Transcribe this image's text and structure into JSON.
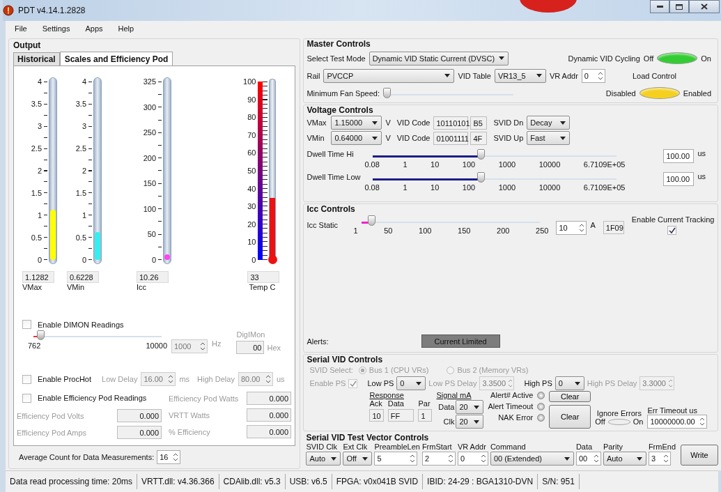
{
  "window": {
    "title": "PDT v4.14.1.2828"
  },
  "menu": [
    "File",
    "Settings",
    "Apps",
    "Help"
  ],
  "output": {
    "title": "Output",
    "tabs": [
      {
        "label": "Historical",
        "selected": false
      },
      {
        "label": "Scales and Efficiency Pod",
        "selected": true
      }
    ],
    "gauges": [
      {
        "kind": "tube",
        "ticks": [
          "4",
          "3.5",
          "3",
          "2.5",
          "2",
          "1.5",
          "1",
          "0.5",
          "0"
        ],
        "level": 0.282,
        "color": "#ffff00",
        "value": "1.1282",
        "label": "VMax"
      },
      {
        "kind": "tube",
        "ticks": [
          "4",
          "3.5",
          "3",
          "2.5",
          "2",
          "1.5",
          "1",
          "0.5",
          "0"
        ],
        "level": 0.156,
        "color": "#33f0f0",
        "value": "0.6228",
        "label": "VMin"
      },
      {
        "kind": "tube",
        "ticks": [
          "325",
          "300",
          "250",
          "200",
          "150",
          "100",
          "50",
          "0"
        ],
        "level": 0.032,
        "color": "#ff44ee",
        "value": "10.26",
        "label": "Icc"
      },
      {
        "kind": "thermometer",
        "ticks": [
          "100",
          "90",
          "80",
          "70",
          "60",
          "50",
          "40",
          "30",
          "20",
          "10",
          "0"
        ],
        "level": 0.33,
        "color": "#ee1111",
        "value": "33",
        "label": "Temp C"
      }
    ],
    "dimon": {
      "label": "Enable DIMON Readings",
      "checked": false,
      "min": "762",
      "max": "10000",
      "level": 0.03,
      "value": "1000",
      "unit": "Hz",
      "digimon_label": "DigIMon",
      "digimon_value": "00",
      "digimon_unit": "Hex",
      "disabled": true
    },
    "prochot": {
      "label": "Enable ProcHot",
      "checked": false,
      "disabled": true,
      "low_label": "Low Delay",
      "low_value": "16.00",
      "low_unit": "ms",
      "high_label": "High Delay",
      "high_value": "80.00",
      "high_unit": "us"
    },
    "efficiency": {
      "label": "Enable Efficiency Pod Readings",
      "checked": false,
      "disabled": true,
      "left_fields": [
        {
          "label": "Efficiency Pod Volts",
          "value": "0.000"
        },
        {
          "label": "Efficiency Pod Amps",
          "value": "0.000"
        }
      ],
      "right_fields": [
        {
          "label": "Efficiency Pod Watts",
          "value": "0.000"
        },
        {
          "label": "VRTT Watts",
          "value": "0.000"
        },
        {
          "label": "% Efficiency",
          "value": "0.000"
        }
      ]
    },
    "average": {
      "label": "Average Count for Data Measurements:",
      "value": "16"
    }
  },
  "master": {
    "title": "Master Controls",
    "mode_label": "Select Test Mode",
    "mode_value": "Dynamic VID Static Current  (DVSC)",
    "cycling": {
      "label": "Dynamic VID Cycling",
      "off": "Off",
      "on": "On",
      "color": "#33cc33"
    },
    "rail_label": "Rail",
    "rail_value": "PVCCP",
    "vid_table_label": "VID Table",
    "vid_table_value": "VR13_5",
    "vr_addr_label": "VR Addr",
    "vr_addr_value": "0",
    "load": {
      "label": "Load Control",
      "off": "Disabled",
      "on": "Enabled",
      "color": "#f5d020"
    },
    "fan": {
      "label": "Minimum Fan Speed:",
      "level": 0.0
    }
  },
  "voltage": {
    "title": "Voltage Controls",
    "rows": [
      {
        "label": "VMax",
        "value": "1.15000",
        "unit": "V",
        "code_label": "VID Code",
        "code": "10110101",
        "hex": "B5",
        "svid_label": "SVID Dn",
        "svid_value": "Decay"
      },
      {
        "label": "VMin",
        "value": "0.64000",
        "unit": "V",
        "code_label": "VID Code",
        "code": "01001111",
        "hex": "4F",
        "svid_label": "SVID Up",
        "svid_value": "Fast"
      }
    ],
    "dwell": [
      {
        "label": "Dwell Time Hi",
        "level": 0.44,
        "ticks": [
          "0.08",
          "1",
          "10",
          "100",
          "1000",
          "10000",
          "6.7109E+05"
        ],
        "value": "100.00",
        "unit": "us"
      },
      {
        "label": "Dwell Time Low",
        "level": 0.44,
        "ticks": [
          "0.08",
          "1",
          "10",
          "100",
          "1000",
          "10000",
          "6.7109E+05"
        ],
        "value": "100.00",
        "unit": "us"
      }
    ]
  },
  "icc": {
    "title": "Icc Controls",
    "label": "Icc Static",
    "level": 0.036,
    "ticks": [
      "1",
      "50",
      "100",
      "150",
      "200",
      "250"
    ],
    "value": "10",
    "unit": "A",
    "hex": "1F09",
    "tracking_label": "Enable Current Tracking",
    "tracking_checked": true,
    "alerts_label": "Alerts:",
    "alert_badge": "Current Limited"
  },
  "serial": {
    "title": "Serial VID Controls",
    "select_label": "SVID Select:",
    "disabled": true,
    "buses": [
      {
        "label": "Bus 1 (CPU VRs)",
        "selected": true
      },
      {
        "label": "Bus 2 (Memory VRs)",
        "selected": false
      }
    ],
    "enable_ps_label": "Enable PS",
    "enable_ps_checked": true,
    "low_ps_label": "Low PS",
    "low_ps_value": "0",
    "low_delay_label": "Low PS Delay",
    "low_delay_value": "3.3500",
    "high_ps_label": "High PS",
    "high_ps_value": "0",
    "high_delay_label": "High PS Delay",
    "high_delay_value": "3.3000",
    "response_title": "Response",
    "response": [
      {
        "label": "Ack",
        "value": "10"
      },
      {
        "label": "Data",
        "value": "FF"
      },
      {
        "label": "Par",
        "value": "1"
      }
    ],
    "signal_title": "Signal mA",
    "signal": [
      {
        "label": "Data",
        "value": "20"
      },
      {
        "label": "Clk",
        "value": "20"
      }
    ],
    "alerts": [
      "Alert# Active",
      "Alert Timeout",
      "NAK Error"
    ],
    "clear_buttons": [
      "Clear",
      "Clear"
    ],
    "ignore_label": "Ignore Errors",
    "ignore_off": "Off",
    "ignore_on": "On",
    "ignore_enabled": false,
    "timeout_label": "Err Timeout us",
    "timeout_value": "10000000.00"
  },
  "vector": {
    "title": "Serial VID Test Vector Controls",
    "fields": [
      {
        "kind": "select",
        "label": "SVID Clk",
        "value": "Auto"
      },
      {
        "kind": "select",
        "label": "Ext Clk",
        "value": "Off"
      },
      {
        "kind": "spin",
        "label": "PreambleLen",
        "value": "5"
      },
      {
        "kind": "spin",
        "label": "FrmStart",
        "value": "2"
      },
      {
        "kind": "spin",
        "label": "VR Addr",
        "value": "0"
      },
      {
        "kind": "select",
        "label": "Command",
        "value": "00 (Extended)"
      },
      {
        "kind": "spin",
        "label": "Data",
        "value": "00"
      },
      {
        "kind": "select",
        "label": "Parity",
        "value": "Auto"
      },
      {
        "kind": "spin",
        "label": "FrmEnd",
        "value": "3"
      }
    ],
    "button": "Write"
  },
  "status_bar": [
    "Data read processing time: 20ms",
    "VRTT.dll: v4.36.366",
    "CDAlib.dll: v5.3",
    "USB: v6.5",
    "FPGA: v0x041B SVID",
    "IBID: 24-29 : BGA1310-DVN",
    "S/N: 951"
  ]
}
